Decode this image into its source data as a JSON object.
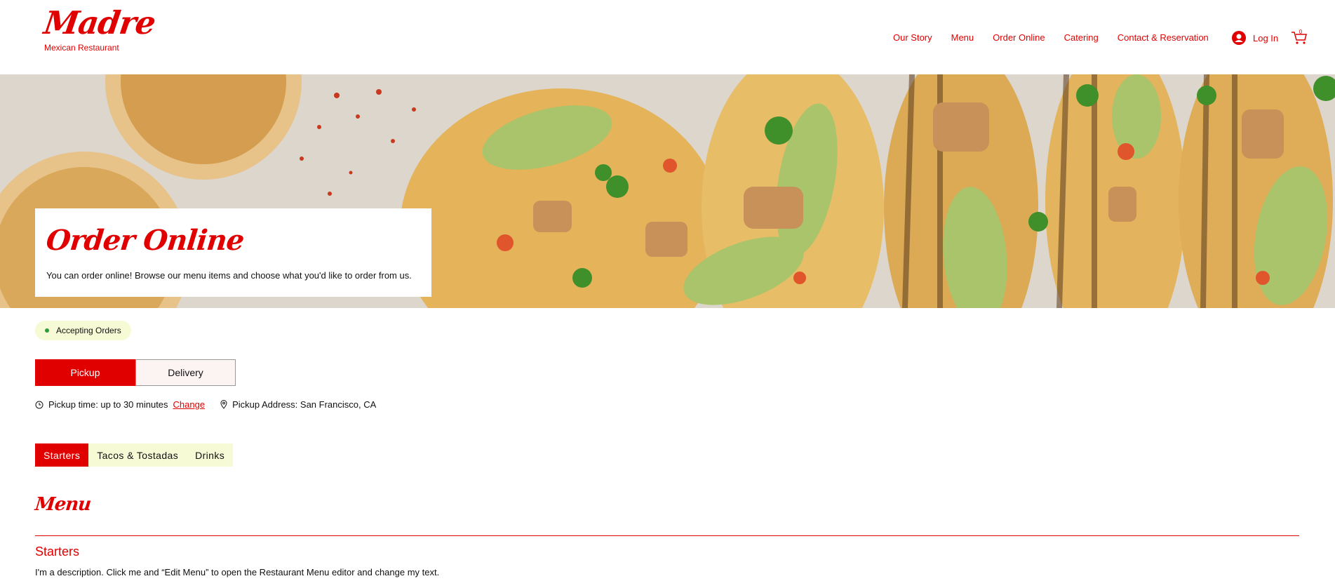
{
  "brand": {
    "name": "Madre",
    "subtitle": "Mexican Restaurant"
  },
  "nav": {
    "items": [
      "Our Story",
      "Menu",
      "Order Online",
      "Catering",
      "Contact & Reservation"
    ]
  },
  "account": {
    "login_label": "Log In",
    "cart_count": "0"
  },
  "hero": {
    "title": "Order Online",
    "description": "You can order online! Browse our menu items and choose what you'd like to order from us."
  },
  "status": {
    "label": "Accepting Orders"
  },
  "fulfillment": {
    "pickup_label": "Pickup",
    "delivery_label": "Delivery"
  },
  "pickup_info": {
    "time_text": "Pickup time: up to 30 minutes",
    "change_label": "Change",
    "address_text": "Pickup Address: San Francisco, CA"
  },
  "categories": {
    "tabs": [
      "Starters",
      "Tacos & Tostadas",
      "Drinks"
    ],
    "active": "Starters"
  },
  "menu": {
    "title": "Menu",
    "section_title": "Starters",
    "section_description": "I'm a description. Click me and “Edit Menu” to open the Restaurant Menu editor and change my text."
  },
  "colors": {
    "accent": "#e10000",
    "status_bg": "#f6fbd6",
    "status_dot": "#2e9b3c"
  }
}
